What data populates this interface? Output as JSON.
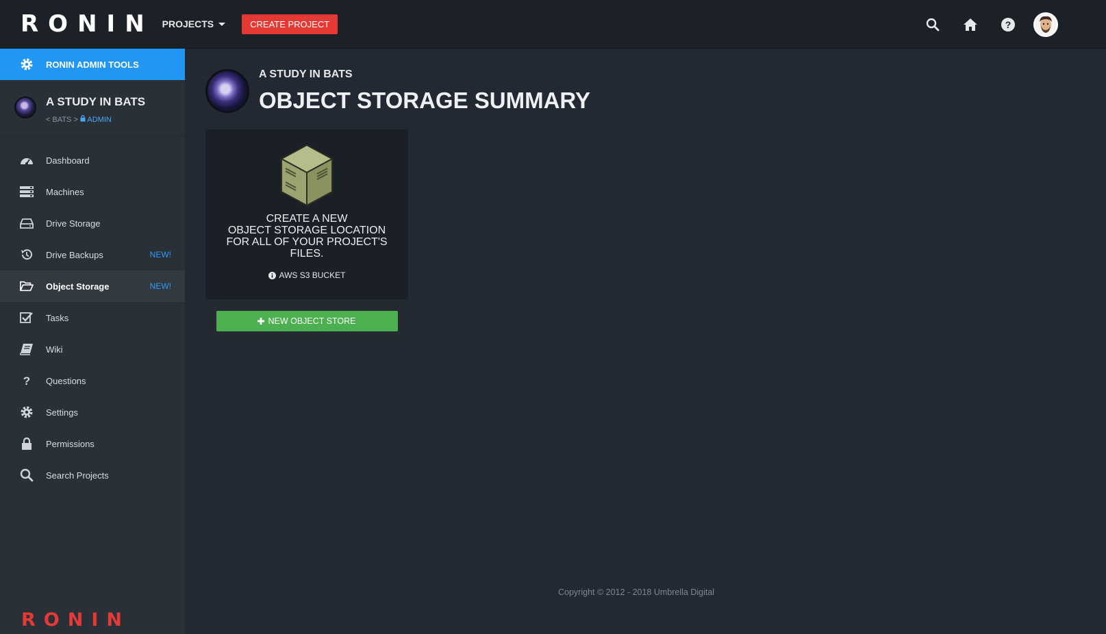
{
  "topbar": {
    "logo": "RONIN",
    "projects_label": "PROJECTS",
    "create_project_label": "CREATE PROJECT",
    "icons": [
      "search-icon",
      "home-icon",
      "help-icon",
      "user-avatar"
    ]
  },
  "sidebar": {
    "admin_tools_label": "RONIN ADMIN TOOLS",
    "project_title": "A STUDY IN BATS",
    "crumb_prefix": "< BATS >",
    "crumb_admin": "ADMIN",
    "items": [
      {
        "label": "Dashboard",
        "icon": "dashboard-icon",
        "badge": ""
      },
      {
        "label": "Machines",
        "icon": "machines-icon",
        "badge": ""
      },
      {
        "label": "Drive Storage",
        "icon": "drive-icon",
        "badge": ""
      },
      {
        "label": "Drive Backups",
        "icon": "backup-icon",
        "badge": "NEW!"
      },
      {
        "label": "Object Storage",
        "icon": "folder-open-icon",
        "badge": "NEW!"
      },
      {
        "label": "Tasks",
        "icon": "tasks-icon",
        "badge": ""
      },
      {
        "label": "Wiki",
        "icon": "book-icon",
        "badge": ""
      },
      {
        "label": "Questions",
        "icon": "question-icon",
        "badge": ""
      },
      {
        "label": "Settings",
        "icon": "gear-icon",
        "badge": ""
      },
      {
        "label": "Permissions",
        "icon": "lock-icon",
        "badge": ""
      },
      {
        "label": "Search Projects",
        "icon": "search-icon",
        "badge": ""
      }
    ],
    "active_item": "Object Storage",
    "footer_logo": "RONIN"
  },
  "main": {
    "header_sub": "A STUDY IN BATS",
    "header_title": "OBJECT STORAGE SUMMARY",
    "card": {
      "line1": "CREATE A NEW",
      "line2": "OBJECT STORAGE LOCATION",
      "line3": "FOR ALL OF YOUR PROJECT'S",
      "line4": "FILES.",
      "aws_label": "AWS S3 BUCKET",
      "button_label": "NEW OBJECT STORE"
    },
    "copyright": "Copyright © 2012 - 2018 Umbrella Digital"
  },
  "colors": {
    "accent_blue": "#2196f3",
    "create_red": "#e53935",
    "success_green": "#4caf50",
    "background": "#222932",
    "sidebar": "#293038"
  }
}
